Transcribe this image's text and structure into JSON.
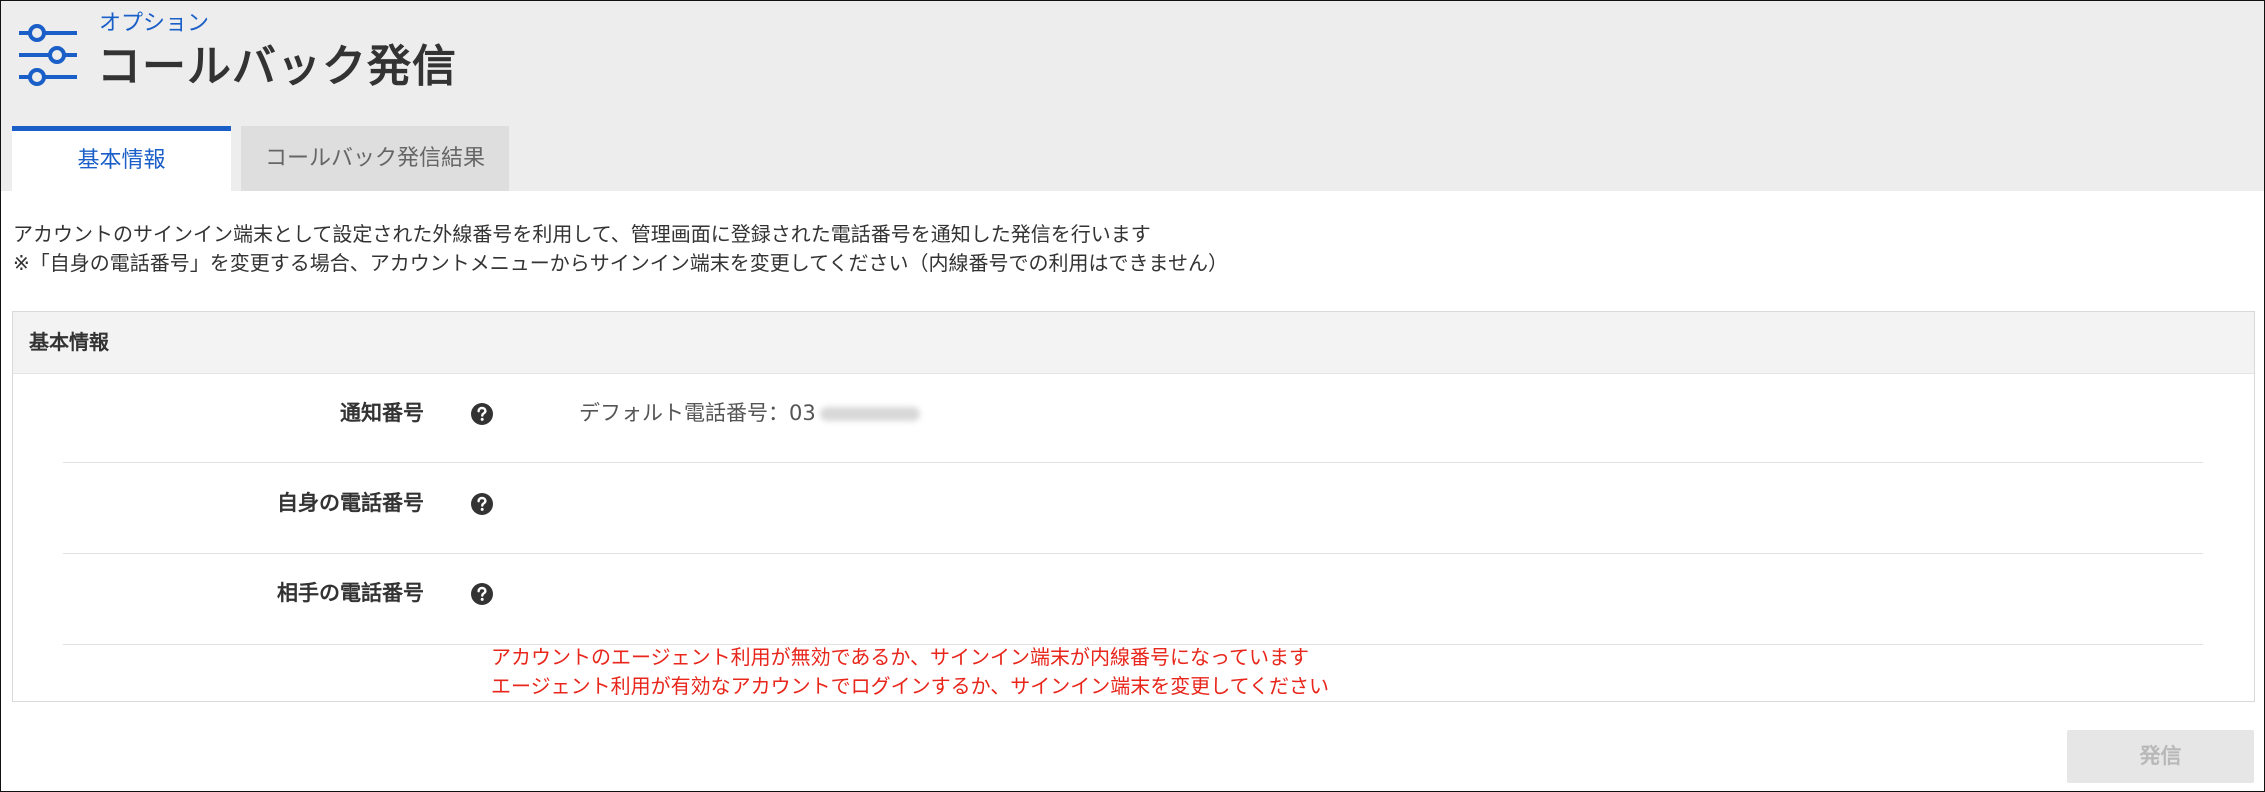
{
  "header": {
    "breadcrumb": "オプション",
    "title": "コールバック発信",
    "icon": "settings-sliders-icon",
    "accent_color": "#1a5fc8"
  },
  "tabs": [
    {
      "label": "基本情報",
      "active": true
    },
    {
      "label": "コールバック発信結果",
      "active": false
    }
  ],
  "description": {
    "line1": "アカウントのサインイン端末として設定された外線番号を利用して、管理画面に登録された電話番号を通知した発信を行います",
    "line2": "※「自身の電話番号」を変更する場合、アカウントメニューからサインイン端末を変更してください（内線番号での利用はできません）"
  },
  "panel": {
    "title": "基本情報",
    "rows": [
      {
        "label": "通知番号",
        "help_icon": "question-circle-icon",
        "value": "デフォルト電話番号：03"
      },
      {
        "label": "自身の電話番号",
        "help_icon": "question-circle-icon",
        "value": ""
      },
      {
        "label": "相手の電話番号",
        "help_icon": "question-circle-icon",
        "value": ""
      }
    ],
    "error": {
      "color": "#e8261b",
      "line1": "アカウントのエージェント利用が無効であるか、サインイン端末が内線番号になっています",
      "line2": "エージェント利用が有効なアカウントでログインするか、サインイン端末を変更してください"
    }
  },
  "actions": {
    "send_label": "発信",
    "send_disabled": true
  }
}
